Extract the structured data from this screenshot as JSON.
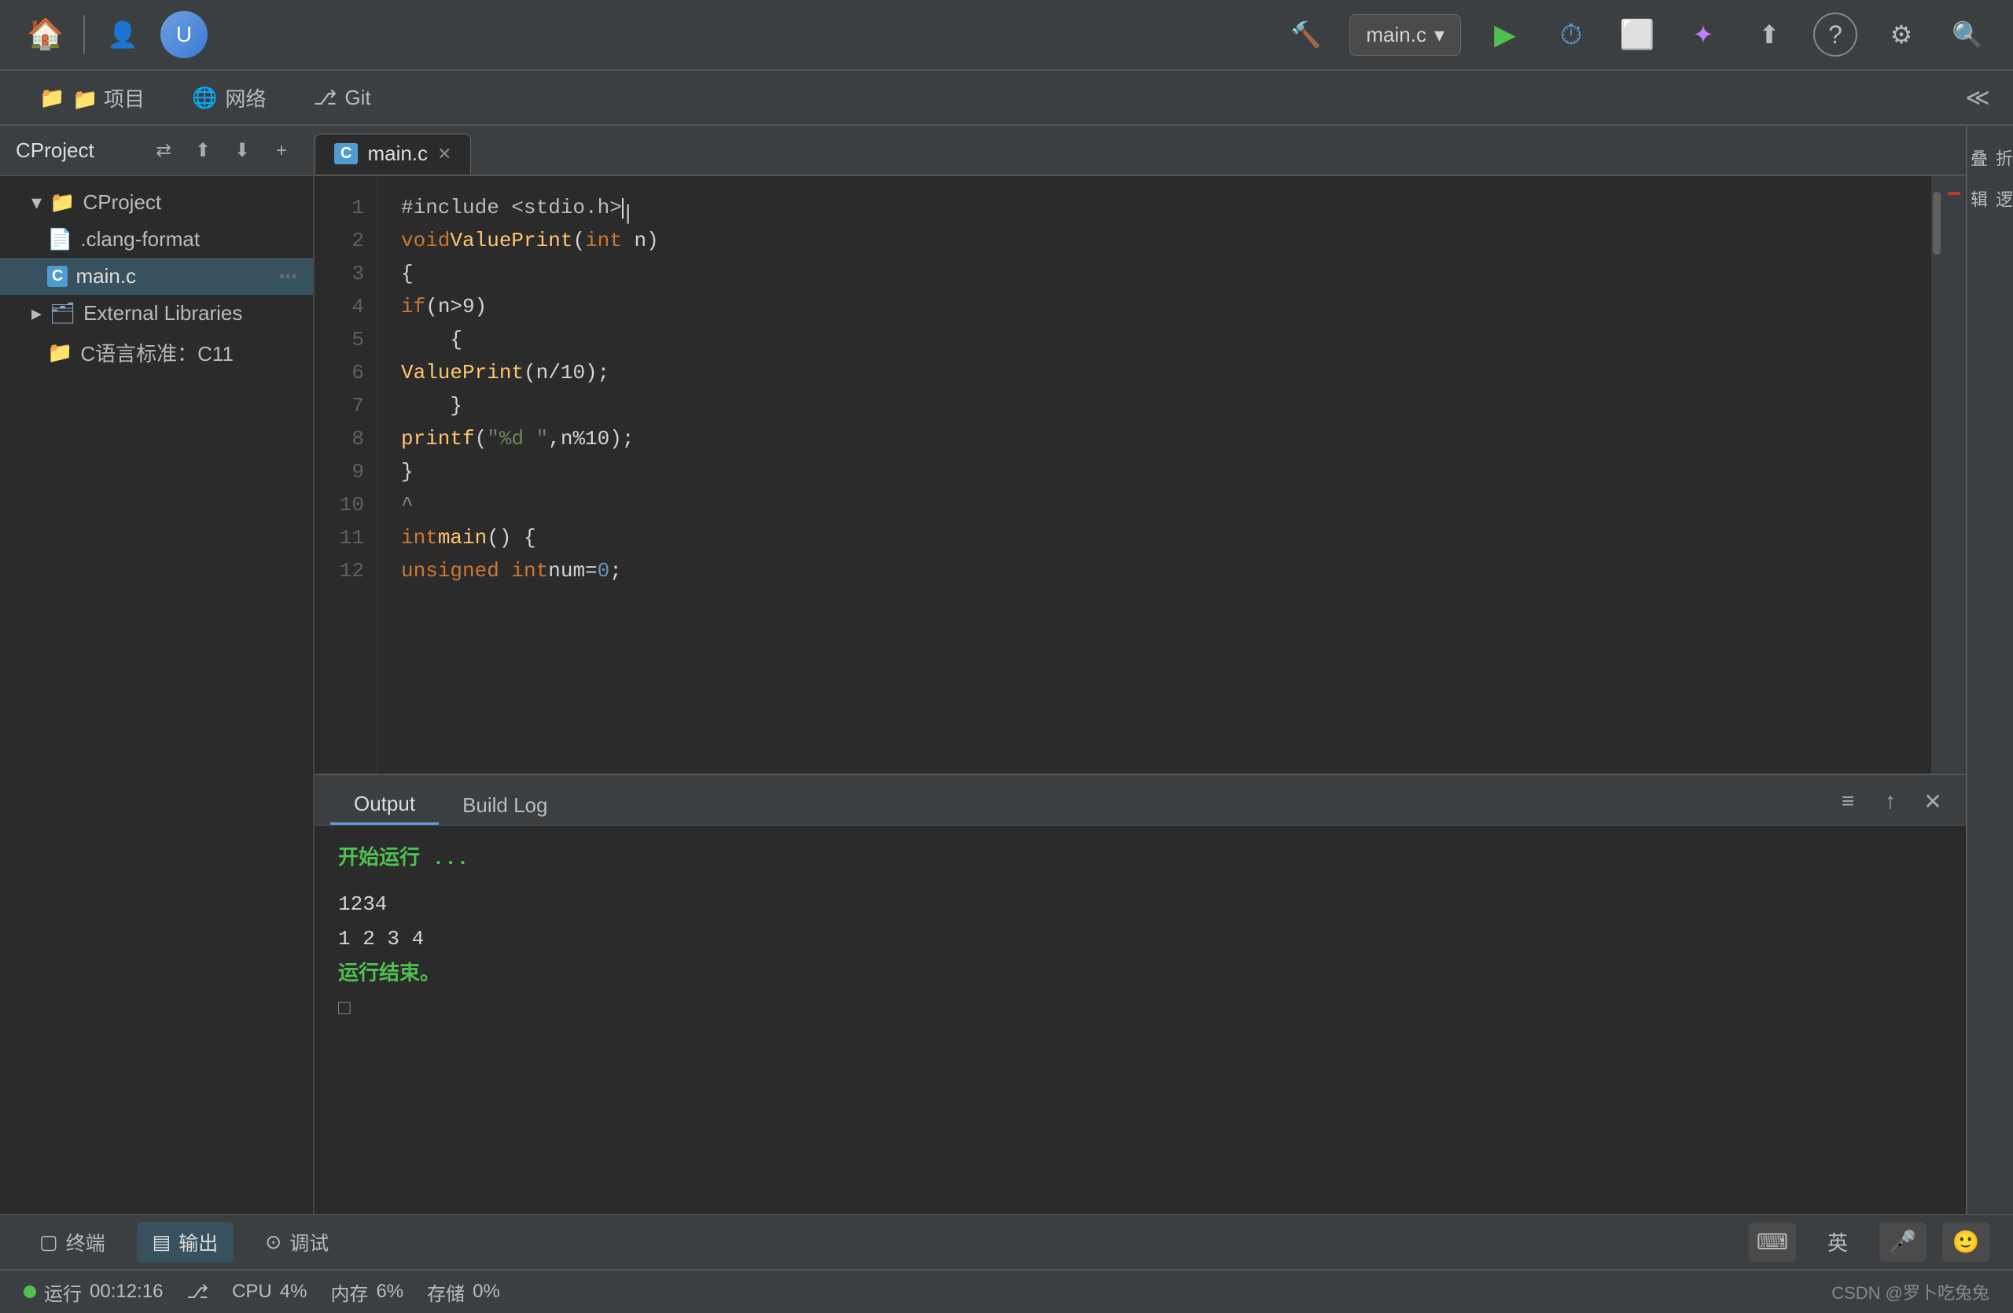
{
  "titlebar": {
    "home_label": "🏠",
    "user_label": "👤",
    "avatar_label": "U",
    "run_config": "main.c",
    "run_config_arrow": "▾",
    "play_icon": "▶",
    "debug_icon": "🐛",
    "stop_icon": "⬜",
    "ai_icon": "✦",
    "upload_icon": "⬆",
    "help_icon": "?",
    "settings_icon": "⚙",
    "search_icon": "🔍",
    "hammer_icon": "🔨"
  },
  "menubar": {
    "items": [
      {
        "label": "📁 项目",
        "id": "project"
      },
      {
        "label": "🌐 网络",
        "id": "network"
      },
      {
        "label": "⎇ Git",
        "id": "git"
      }
    ],
    "collapse_icon": "≪"
  },
  "sidebar": {
    "title": "CProject",
    "actions": [
      "⇄",
      "⬆",
      "⬇",
      "+"
    ],
    "tree": [
      {
        "label": "CProject",
        "type": "folder",
        "indent": 1,
        "expanded": true
      },
      {
        "label": ".clang-format",
        "type": "file",
        "indent": 2
      },
      {
        "label": "main.c",
        "type": "c-file",
        "indent": 2,
        "active": true
      },
      {
        "label": "External Libraries",
        "type": "ext-folder",
        "indent": 1,
        "expanded": false
      },
      {
        "label": "C语言标准：C11",
        "type": "folder",
        "indent": 2
      }
    ]
  },
  "editor": {
    "tab_name": "main.c",
    "tab_icon": "C",
    "lines": [
      {
        "num": 1,
        "code": "#include <stdio.h>",
        "type": "include"
      },
      {
        "num": 2,
        "code": "void ValuePrint(int n)",
        "type": "normal"
      },
      {
        "num": 3,
        "code": "{",
        "type": "normal"
      },
      {
        "num": 4,
        "code": "    if(n>9)",
        "type": "normal"
      },
      {
        "num": 5,
        "code": "    {",
        "type": "normal"
      },
      {
        "num": 6,
        "code": "        ValuePrint(n/10);",
        "type": "normal"
      },
      {
        "num": 7,
        "code": "    }",
        "type": "normal"
      },
      {
        "num": 8,
        "code": "    printf(\"%d \",n%10);",
        "type": "normal"
      },
      {
        "num": 9,
        "code": "}",
        "type": "normal"
      },
      {
        "num": 10,
        "code": "",
        "type": "normal"
      },
      {
        "num": 11,
        "code": "int main() {",
        "type": "normal"
      },
      {
        "num": 12,
        "code": "    unsigned int num=0;",
        "type": "normal"
      }
    ]
  },
  "output_panel": {
    "tabs": [
      {
        "label": "Output",
        "id": "output",
        "active": true
      },
      {
        "label": "Build Log",
        "id": "build-log",
        "active": false
      }
    ],
    "content": {
      "run_start": "开始运行 ...",
      "output_line1": "1234",
      "output_line2": "1 2 3 4",
      "run_end": "运行结束。",
      "cursor": "□"
    }
  },
  "bottom_toolbar": {
    "tools": [
      {
        "label": "终端",
        "id": "terminal",
        "icon": "▢"
      },
      {
        "label": "输出",
        "id": "output",
        "icon": "▤",
        "active": true
      },
      {
        "label": "调试",
        "id": "debug",
        "icon": "⊙"
      }
    ],
    "ime_icon": "⌨",
    "lang": "英",
    "mic_icon": "🎤",
    "emoji_icon": "🙂"
  },
  "statusbar": {
    "run_status": "运行",
    "run_time": "00:12:16",
    "branch_icon": "⎇",
    "cpu_label": "CPU",
    "cpu_value": "4%",
    "memory_label": "内存",
    "memory_value": "6%",
    "storage_label": "存储",
    "storage_value": "0%",
    "csdn_label": "CSDN @罗卜吃兔兔"
  },
  "right_sidebar": {
    "items": [
      {
        "label": "折\n叠",
        "id": "fold"
      },
      {
        "label": "逻\n辑",
        "id": "logic"
      }
    ]
  }
}
